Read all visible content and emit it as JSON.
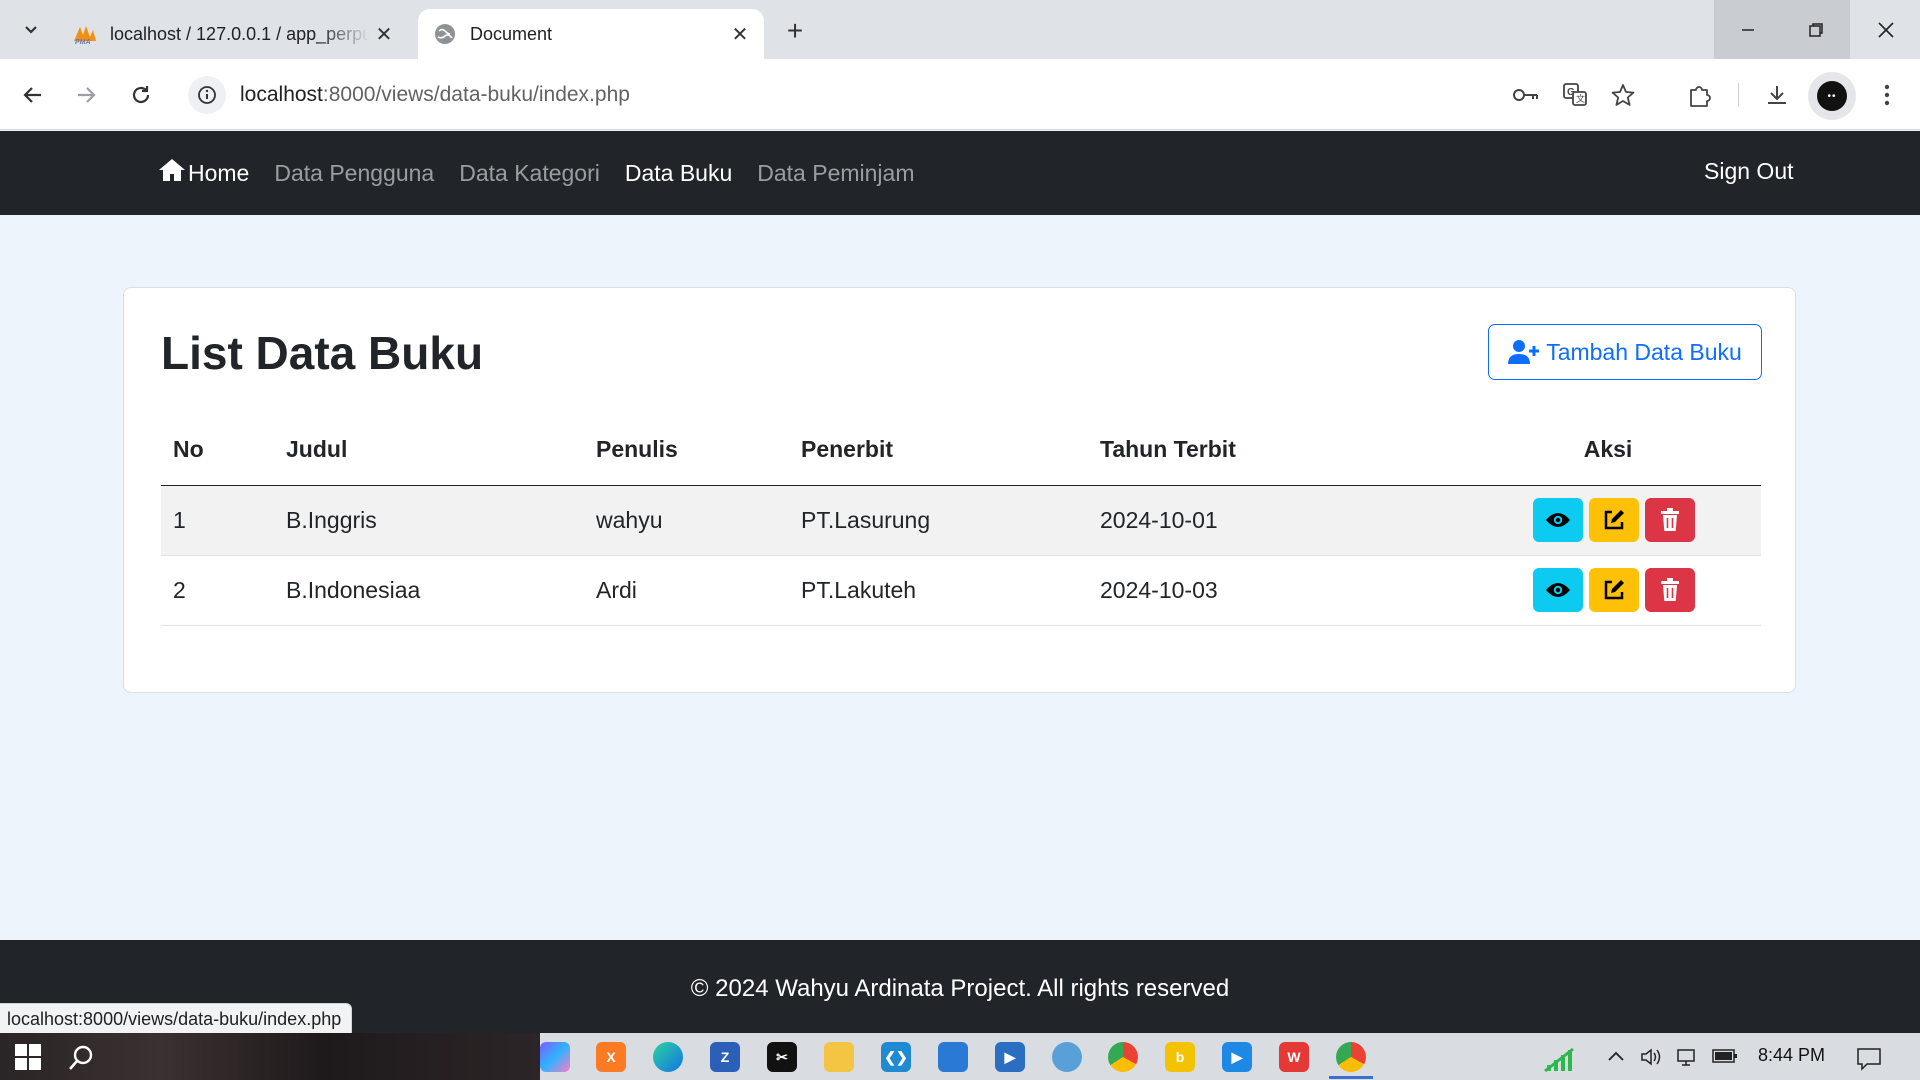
{
  "browser": {
    "tabs": [
      {
        "title": "localhost / 127.0.0.1 / app_perpustakaan",
        "favicon": "phpmyadmin-icon",
        "active": false
      },
      {
        "title": "Document",
        "favicon": "globe-icon",
        "active": true
      }
    ],
    "url_host": "localhost",
    "url_path": ":8000/views/data-buku/index.php",
    "status_url": "localhost:8000/views/data-buku/index.php"
  },
  "navbar": {
    "items": [
      {
        "label": "Home",
        "icon": "house-icon"
      },
      {
        "label": "Data Pengguna"
      },
      {
        "label": "Data Kategori"
      },
      {
        "label": "Data Buku"
      },
      {
        "label": "Data Peminjam"
      }
    ],
    "active": "Data Buku",
    "signout_label": "Sign Out"
  },
  "page": {
    "title": "List Data Buku",
    "add_button_label": "Tambah Data Buku"
  },
  "table": {
    "headers": [
      "No",
      "Judul",
      "Penulis",
      "Penerbit",
      "Tahun Terbit",
      "Aksi"
    ],
    "rows": [
      {
        "no": "1",
        "judul": "B.Inggris",
        "penulis": "wahyu",
        "penerbit": "PT.Lasurung",
        "tahun": "2024-10-01"
      },
      {
        "no": "2",
        "judul": "B.Indonesiaa",
        "penulis": "Ardi",
        "penerbit": "PT.Lakuteh",
        "tahun": "2024-10-03"
      }
    ],
    "actions": [
      "eye-icon",
      "edit-icon",
      "trash-icon"
    ]
  },
  "footer": {
    "text": "© 2024 Wahyu Ardinata Project. All rights reserved"
  },
  "taskbar": {
    "time": "8:44 PM"
  },
  "colors": {
    "navbar_bg": "#212529",
    "page_bg": "#eef4fc",
    "primary": "#0d6efd",
    "info": "#0dcaf0",
    "warning": "#ffc107",
    "danger": "#dc3545"
  }
}
